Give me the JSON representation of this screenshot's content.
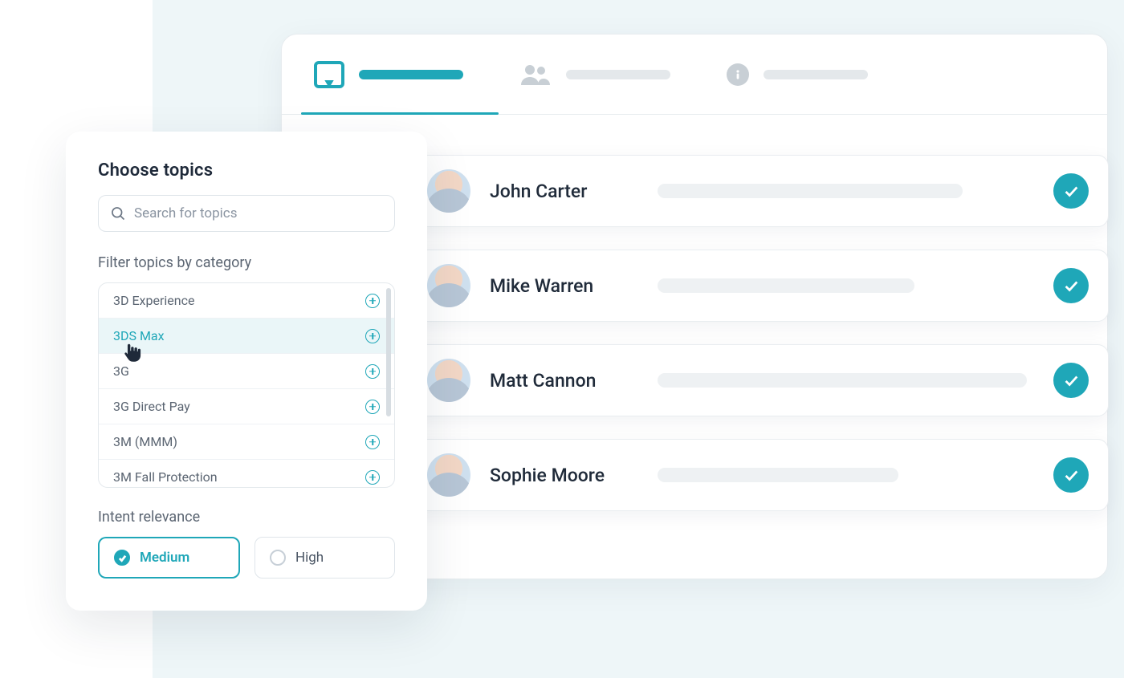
{
  "panel": {
    "title": "Choose topics",
    "search_placeholder": "Search for topics",
    "filter_label": "Filter topics by category",
    "topics": [
      {
        "label": "3D Experience",
        "hover": false
      },
      {
        "label": "3DS Max",
        "hover": true
      },
      {
        "label": "3G",
        "hover": false
      },
      {
        "label": "3G Direct Pay",
        "hover": false
      },
      {
        "label": "3M (MMM)",
        "hover": false
      },
      {
        "label": "3M Fall Protection",
        "hover": false
      }
    ],
    "relevance_label": "Intent relevance",
    "relevance": [
      {
        "label": "Medium",
        "selected": true
      },
      {
        "label": "High",
        "selected": false
      }
    ]
  },
  "people": [
    {
      "name": "John Carter"
    },
    {
      "name": "Mike Warren"
    },
    {
      "name": "Matt Cannon"
    },
    {
      "name": "Sophie Moore"
    }
  ]
}
